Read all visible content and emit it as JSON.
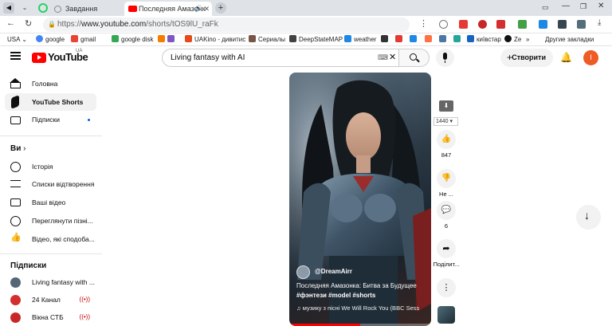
{
  "browser": {
    "tabs": [
      {
        "label": "Завдання"
      },
      {
        "label": "Последняя Амазонк"
      }
    ],
    "url_scheme": "https://",
    "url_host": "www.youtube.com",
    "url_path": "/shorts/tOS9lU_raFk",
    "bookmarks": [
      {
        "label": "USA",
        "color": "#ffffff"
      },
      {
        "label": "google",
        "color": "#4285f4"
      },
      {
        "label": "gmail",
        "color": "#ea4335"
      },
      {
        "label": "google disk",
        "color": "#34a853"
      },
      {
        "label": "UAKino - дивитис",
        "color": "#e64a19"
      },
      {
        "label": "Сериалы",
        "color": "#795548"
      },
      {
        "label": "DeepStateMAP",
        "color": "#424242"
      },
      {
        "label": "weather",
        "color": "#1e88e5"
      },
      {
        "label": "київстар",
        "color": "#1565c0"
      },
      {
        "label": "Ze",
        "color": "#111111"
      }
    ],
    "other_bookmarks": "Другие закладки"
  },
  "youtube": {
    "logo_text": "YouTube",
    "region": "UA",
    "search_value": "Living fantasy with AI",
    "create_label": "Створити",
    "avatar_letter": "I"
  },
  "sidebar": {
    "main": [
      {
        "label": "Головна"
      },
      {
        "label": "YouTube Shorts"
      },
      {
        "label": "Підписки"
      }
    ],
    "you_heading": "Ви",
    "you_items": [
      {
        "label": "Історія"
      },
      {
        "label": "Списки відтворення"
      },
      {
        "label": "Ваші відео"
      },
      {
        "label": "Переглянути пізні..."
      },
      {
        "label": "Відео, які сподоба..."
      }
    ],
    "subs_heading": "Підписки",
    "subs": [
      {
        "label": "Living fantasy with ...",
        "color": "#556677"
      },
      {
        "label": "24 Канал",
        "color": "#d32f2f"
      },
      {
        "label": "Вікна СТБ",
        "color": "#c62828"
      }
    ]
  },
  "short": {
    "channel": "@DreamAirr",
    "title": "Последняя Амазонка: Битва за Будущее",
    "tags": "#фэнтези #model #shorts",
    "music": "музику з пісні We Will Rock You (BBC Sess"
  },
  "actions": {
    "quality": "1440",
    "likes": "847",
    "dislike_label": "Не ...",
    "comments": "6",
    "share_label": "Поділит..."
  },
  "colors": {
    "brand_red": "#ff0000",
    "live_red": "#cc0000",
    "accent_blue": "#065fd4"
  }
}
